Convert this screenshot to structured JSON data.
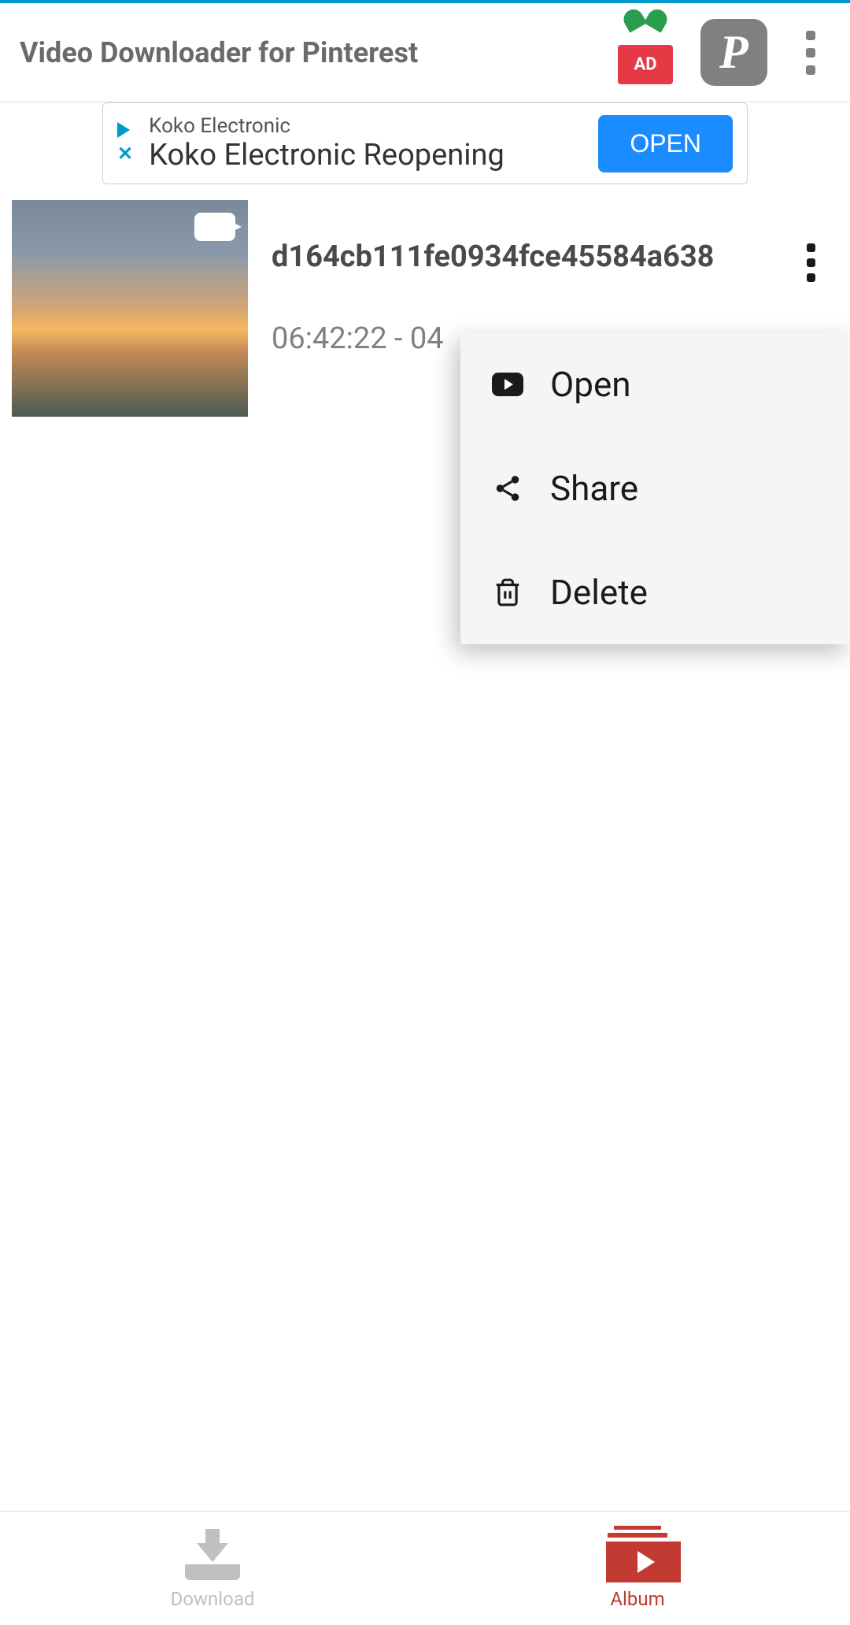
{
  "header": {
    "title": "Video Downloader for Pinterest",
    "ad_badge": "AD"
  },
  "ad_banner": {
    "subtitle": "Koko Electronic",
    "title": "Koko Electronic Reopening",
    "button": "OPEN"
  },
  "video_item": {
    "name": "d164cb111fe0934fce45584a638",
    "time": "06:42:22 - 04"
  },
  "context_menu": {
    "open": "Open",
    "share": "Share",
    "delete": "Delete"
  },
  "bottom_nav": {
    "download": "Download",
    "album": "Album"
  }
}
